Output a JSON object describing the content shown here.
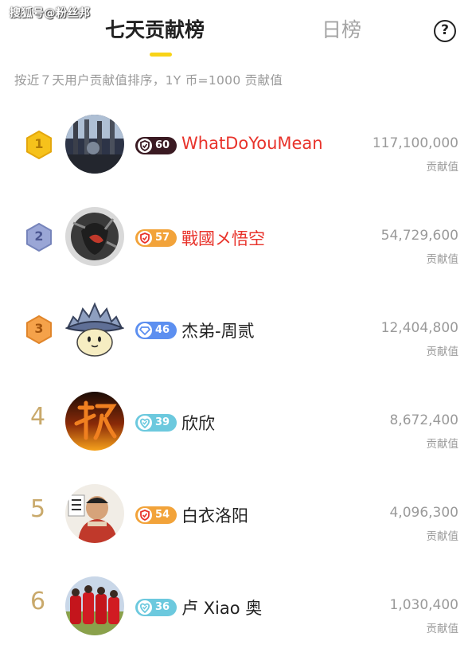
{
  "watermark": "搜狐号@粉丝邦",
  "tabs": {
    "weekly": "七天贡献榜",
    "daily": "日榜"
  },
  "help": "?",
  "subtitle": "按近７天用户贡献值排序，1Y 币=1000 贡献值",
  "score_label": "贡献值",
  "colors": {
    "accent": "#f8d317",
    "highlight_name": "#e8332b",
    "muted": "#9a9a9a"
  },
  "entries": [
    {
      "rank": "1",
      "level": "60",
      "name": "WhatDoYouMean",
      "score": "117,100,000",
      "highlight": true,
      "level_color": "#3a1a22"
    },
    {
      "rank": "2",
      "level": "57",
      "name": "戰國メ悟空",
      "score": "54,729,600",
      "highlight": true,
      "level_color": "#f2a33a"
    },
    {
      "rank": "3",
      "level": "46",
      "name": "杰弟-周贰",
      "score": "12,404,800",
      "highlight": false,
      "level_color": "#5c8ff0"
    },
    {
      "rank": "4",
      "level": "39",
      "name": "欣欣",
      "score": "8,672,400",
      "highlight": false,
      "level_color": "#6cc9de"
    },
    {
      "rank": "5",
      "level": "54",
      "name": "白衣洛阳",
      "score": "4,096,300",
      "highlight": false,
      "level_color": "#f2a33a"
    },
    {
      "rank": "6",
      "level": "36",
      "name": "卢 Xiao 奥",
      "score": "1,030,400",
      "highlight": false,
      "level_color": "#6cc9de"
    }
  ]
}
